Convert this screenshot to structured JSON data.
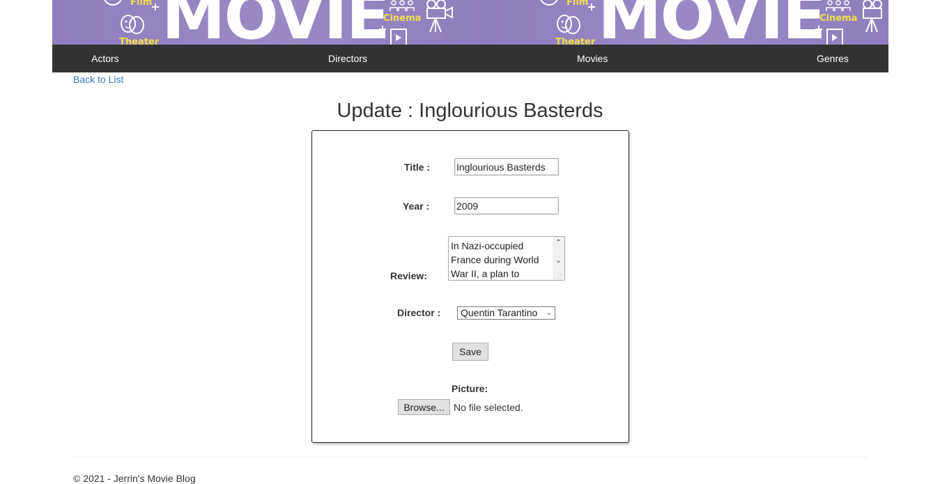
{
  "banner": {
    "word": "MOVIE",
    "labels": [
      "Film",
      "Theater",
      "Cinema"
    ]
  },
  "nav": {
    "actors": "Actors",
    "directors": "Directors",
    "movies": "Movies",
    "genres": "Genres"
  },
  "back_link": "Back to List",
  "page_title": "Update : Inglourious Basterds",
  "form": {
    "title_label": "Title :",
    "title_value": "Inglourious Basterds",
    "year_label": "Year :",
    "year_value": "2009",
    "review_label": "Review:",
    "review_text": "In Nazi-occupied France during World War II, a plan to",
    "director_label": "Director :",
    "director_selected": "Quentin Tarantino",
    "save_label": "Save",
    "picture_label": "Picture:",
    "browse_label": "Browse...",
    "file_status": "No file selected."
  },
  "footer": {
    "text": "© 2021 - Jerrin's Movie Blog"
  },
  "colors": {
    "banner": "#9382c2",
    "navbar": "#333333",
    "link": "#337ab7"
  }
}
